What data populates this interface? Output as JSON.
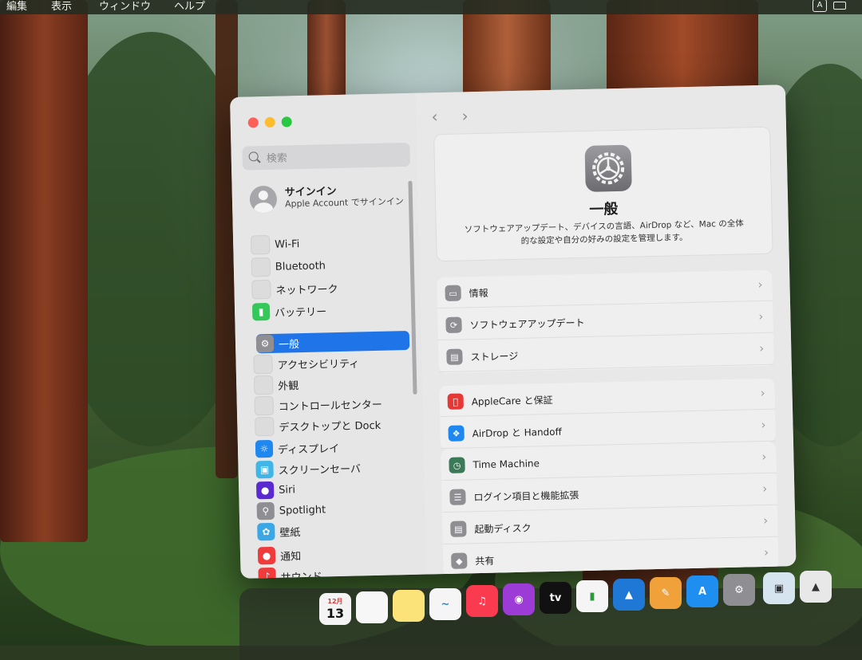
{
  "menubar": {
    "items": [
      "編集",
      "表示",
      "ウィンドウ",
      "ヘルプ"
    ],
    "input_indicator": "A"
  },
  "sidebar": {
    "search_placeholder": "検索",
    "account": {
      "title": "サインイン",
      "subtitle": "Apple Account でサインイン"
    },
    "items": [
      {
        "label": "Wi-Fi",
        "icon": "wifi-icon",
        "color": ""
      },
      {
        "label": "Bluetooth",
        "icon": "bluetooth-icon",
        "color": ""
      },
      {
        "label": "ネットワーク",
        "icon": "network-icon",
        "color": ""
      },
      {
        "label": "バッテリー",
        "icon": "battery-icon",
        "color": "#34c759"
      },
      {
        "label": "一般",
        "icon": "gear-icon",
        "color": "#8e8e93",
        "selected": true
      },
      {
        "label": "アクセシビリティ",
        "icon": "accessibility-icon",
        "color": ""
      },
      {
        "label": "外観",
        "icon": "appearance-icon",
        "color": ""
      },
      {
        "label": "コントロールセンター",
        "icon": "control-center-icon",
        "color": ""
      },
      {
        "label": "デスクトップと Dock",
        "icon": "desktop-dock-icon",
        "color": ""
      },
      {
        "label": "ディスプレイ",
        "icon": "display-icon",
        "color": "#1e88f0"
      },
      {
        "label": "スクリーンセーバ",
        "icon": "screensaver-icon",
        "color": "#3fb5e8"
      },
      {
        "label": "Siri",
        "icon": "siri-icon",
        "color": "#5a2ad0"
      },
      {
        "label": "Spotlight",
        "icon": "spotlight-icon",
        "color": "#8e8e93"
      },
      {
        "label": "壁紙",
        "icon": "wallpaper-icon",
        "color": "#3aa8e6"
      },
      {
        "label": "通知",
        "icon": "notifications-icon",
        "color": "#ef3b3b"
      },
      {
        "label": "サウンド",
        "icon": "sound-icon",
        "color": "#ef3b3b"
      }
    ]
  },
  "main": {
    "hero": {
      "title": "一般",
      "description": "ソフトウェアアップデート、デバイスの言語、AirDrop など、Mac の全体的な設定や自分の好みの設定を管理します。"
    },
    "rows": [
      {
        "label": "情報",
        "icon": "info-laptop-icon",
        "color": "#8e8e93"
      },
      {
        "label": "ソフトウェアアップデート",
        "icon": "software-update-icon",
        "color": "#8e8e93"
      },
      {
        "label": "ストレージ",
        "icon": "storage-icon",
        "color": "#8e8e93"
      },
      {
        "label": "AppleCare と保証",
        "icon": "apple-icon",
        "color": "#e53935"
      },
      {
        "label": "AirDrop と Handoff",
        "icon": "airdrop-icon",
        "color": "#1e88f0"
      },
      {
        "label": "Time Machine",
        "icon": "time-machine-icon",
        "color": "#3a7a57"
      },
      {
        "label": "ログイン項目と機能拡張",
        "icon": "login-items-icon",
        "color": "#8e8e93"
      },
      {
        "label": "起動ディスク",
        "icon": "startup-disk-icon",
        "color": "#8e8e93"
      },
      {
        "label": "共有",
        "icon": "sharing-icon",
        "color": "#8e8e93"
      }
    ]
  },
  "dock": {
    "calendar_month": "12月",
    "calendar_day": "13",
    "tv_label": "tv"
  }
}
